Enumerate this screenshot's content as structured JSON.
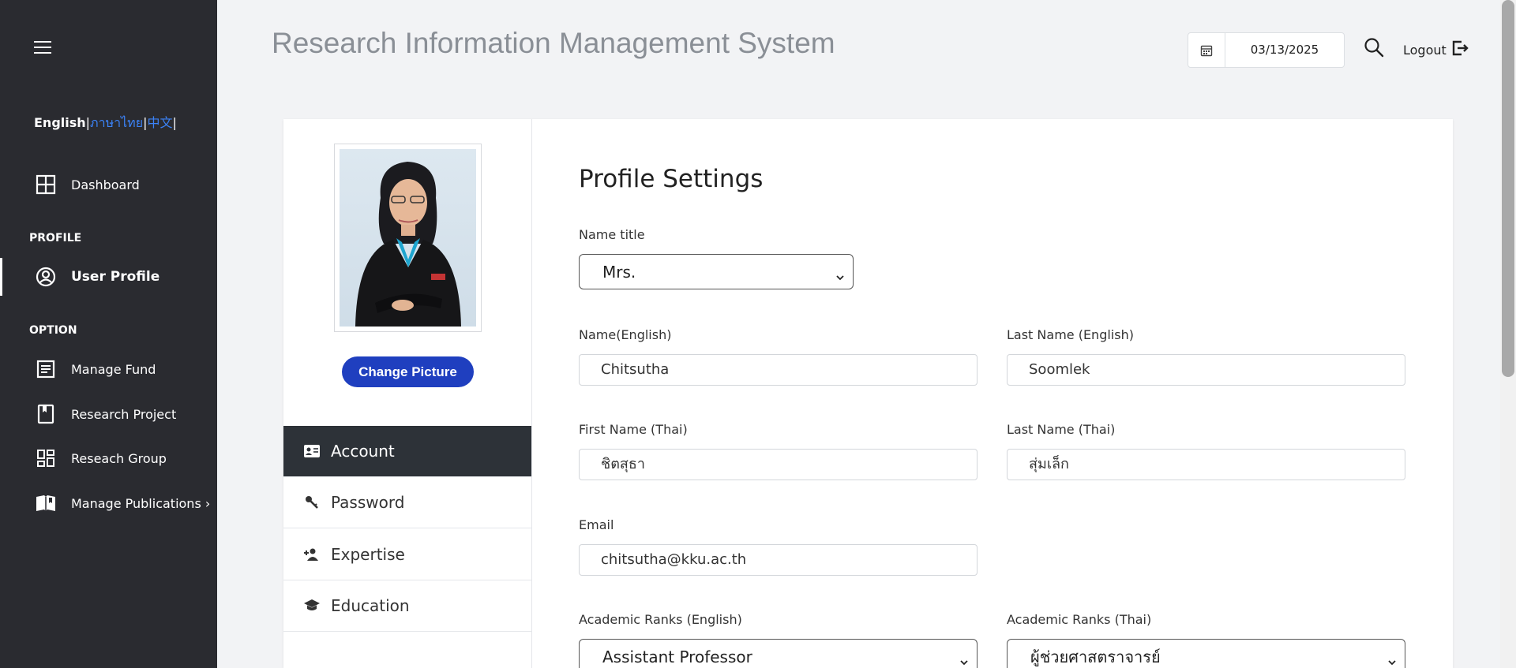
{
  "sidebar": {
    "languages": [
      {
        "label": "English"
      },
      {
        "label": "ภาษาไทย"
      },
      {
        "label": "中文"
      }
    ],
    "separator": "|",
    "dashboard_label": "Dashboard",
    "profile_section": "PROFILE",
    "user_profile_label": "User Profile",
    "option_section": "OPTION",
    "items": [
      {
        "label": "Manage Fund"
      },
      {
        "label": "Research Project"
      },
      {
        "label": "Reseach Group"
      },
      {
        "label": "Manage Publications ›"
      }
    ]
  },
  "header": {
    "title": "Research Information Management System",
    "date": "03/13/2025",
    "logout_label": "Logout"
  },
  "profile": {
    "change_picture_label": "Change Picture",
    "tabs": [
      {
        "label": "Account"
      },
      {
        "label": "Password"
      },
      {
        "label": "Expertise"
      },
      {
        "label": "Education"
      }
    ]
  },
  "form": {
    "title": "Profile Settings",
    "name_title_label": "Name title",
    "name_title_value": "Mrs.",
    "name_en_label": "Name(English)",
    "name_en_value": "Chitsutha",
    "last_en_label": "Last Name (English)",
    "last_en_value": "Soomlek",
    "first_th_label": "First Name (Thai)",
    "first_th_value": "ชิตสุธา",
    "last_th_label": "Last Name (Thai)",
    "last_th_value": "สุ่มเล็ก",
    "email_label": "Email",
    "email_value": "chitsutha@kku.ac.th",
    "rank_en_label": "Academic Ranks (English)",
    "rank_en_value": "Assistant Professor",
    "rank_th_label": "Academic Ranks (Thai)",
    "rank_th_value": "ผู้ช่วยศาสตราจารย์"
  },
  "colors": {
    "sidebar_bg": "#2a2b30",
    "accent": "#1f3fbf",
    "lang_link": "#3b82f6",
    "active_tab": "#2d3238"
  }
}
